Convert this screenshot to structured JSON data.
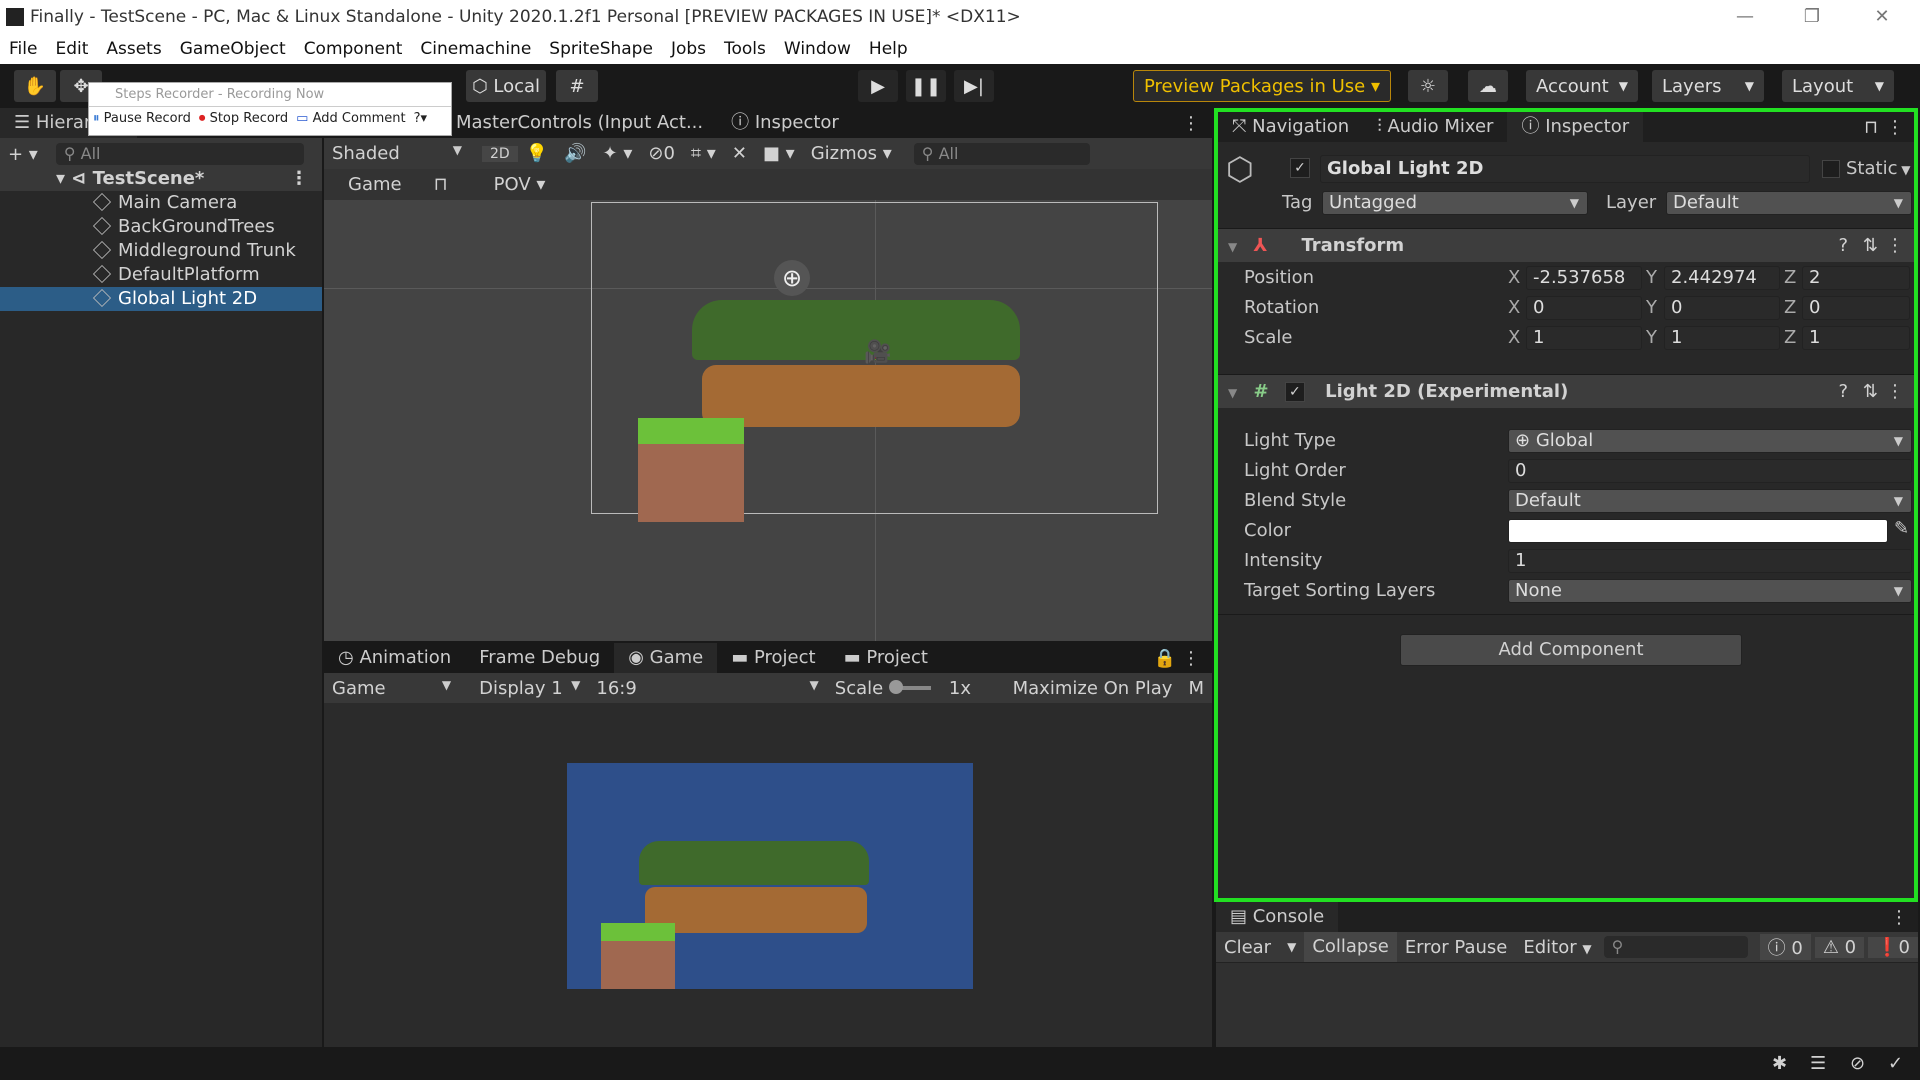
{
  "window": {
    "title": "Finally - TestScene - PC, Mac & Linux Standalone - Unity 2020.1.2f1 Personal [PREVIEW PACKAGES IN USE]* <DX11>"
  },
  "menu": [
    "File",
    "Edit",
    "Assets",
    "GameObject",
    "Component",
    "Cinemachine",
    "SpriteShape",
    "Jobs",
    "Tools",
    "Window",
    "Help"
  ],
  "toolbar": {
    "pivot": "Local",
    "preview": "Preview Packages in Use",
    "account": "Account",
    "layers": "Layers",
    "layout": "Layout"
  },
  "steps_recorder": {
    "title": "Steps Recorder - Recording Now",
    "pause": "Pause Record",
    "stop": "Stop Record",
    "comment": "Add Comment"
  },
  "hierarchy": {
    "tab": "Hierarchy",
    "search": "All",
    "scene": "TestScene*",
    "items": [
      "Main Camera",
      "BackGroundTrees",
      "Middleground Trunk",
      "DefaultPlatform",
      "Global Light 2D"
    ],
    "selected": "Global Light 2D"
  },
  "scene": {
    "tabs": [
      "MasterControls (Input Act...",
      "Inspector"
    ],
    "shading": "Shaded",
    "mode2d": "2D",
    "hidden_count": "0",
    "gizmos": "Gizmos",
    "search": "All",
    "game": "Game",
    "pov": "POV"
  },
  "bottom": {
    "tabs": [
      "Animation",
      "Frame Debug",
      "Game",
      "Project",
      "Project"
    ],
    "active_tab": "Game",
    "game_dropdown": "Game",
    "display": "Display 1",
    "aspect": "16:9",
    "scale_label": "Scale",
    "scale_value": "1x",
    "maximize": "Maximize On Play",
    "more": "M",
    "background_color": "#2e4f8a"
  },
  "inspector": {
    "tabs": [
      "Navigation",
      "Audio Mixer",
      "Inspector"
    ],
    "active_tab": "Inspector",
    "name": "Global Light 2D",
    "active": true,
    "static_label": "Static",
    "tag_label": "Tag",
    "tag": "Untagged",
    "layer_label": "Layer",
    "layer": "Default",
    "transform": {
      "title": "Transform",
      "rows": [
        {
          "label": "Position",
          "x": "-2.537658",
          "y": "2.442974",
          "z": "2"
        },
        {
          "label": "Rotation",
          "x": "0",
          "y": "0",
          "z": "0"
        },
        {
          "label": "Scale",
          "x": "1",
          "y": "1",
          "z": "1"
        }
      ]
    },
    "light2d": {
      "title": "Light 2D (Experimental)",
      "enabled": true,
      "light_type_label": "Light Type",
      "light_type": "Global",
      "light_order_label": "Light Order",
      "light_order": "0",
      "blend_style_label": "Blend Style",
      "blend_style": "Default",
      "color_label": "Color",
      "color": "#ffffff",
      "intensity_label": "Intensity",
      "intensity": "1",
      "target_label": "Target Sorting Layers",
      "target": "None"
    },
    "add_component": "Add Component",
    "highlight_color": "#22e022"
  },
  "console": {
    "tab": "Console",
    "clear": "Clear",
    "collapse": "Collapse",
    "error_pause": "Error Pause",
    "editor": "Editor",
    "info": "0",
    "warn": "0",
    "error": "0"
  }
}
